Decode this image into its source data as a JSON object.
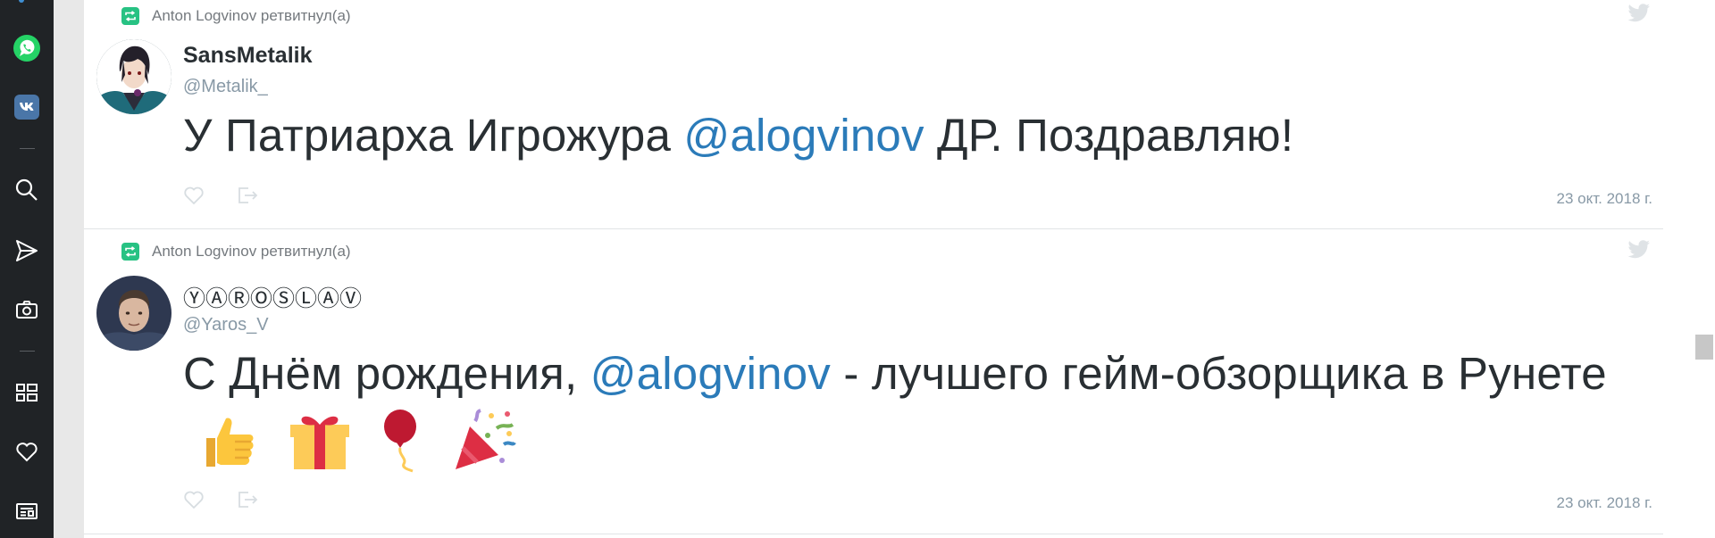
{
  "sidebar": {
    "items": [
      {
        "icon": "whatsapp-icon"
      },
      {
        "icon": "vk-icon"
      },
      {
        "icon": "search-icon"
      },
      {
        "icon": "send-icon"
      },
      {
        "icon": "camera-icon"
      },
      {
        "icon": "apps-grid-icon"
      },
      {
        "icon": "heart-icon"
      },
      {
        "icon": "news-icon"
      }
    ]
  },
  "colors": {
    "sidebar_bg": "#202326",
    "mention": "#2b7bb9",
    "retweet_green": "#27c283",
    "muted": "#8899a6"
  },
  "tweets": [
    {
      "retweet_label": "Anton Logvinov ретвитнул(а)",
      "name": "SansMetalik",
      "handle": "@Metalik_",
      "text_before": "У Патриарха Игрожура ",
      "mention": "@alogvinov",
      "text_after": " ДР. Поздравляю!",
      "date": "23 окт. 2018 г."
    },
    {
      "retweet_label": "Anton Logvinov ретвитнул(а)",
      "name": "ⓎⒶⓇⓄⓈⓁⒶⓋ",
      "handle": "@Yaros_V",
      "text_before": "С Днём рождения, ",
      "mention": "@alogvinov",
      "text_after": " - лучшего гейм-обзорщика в Рунете",
      "date": "23 окт. 2018 г."
    }
  ]
}
